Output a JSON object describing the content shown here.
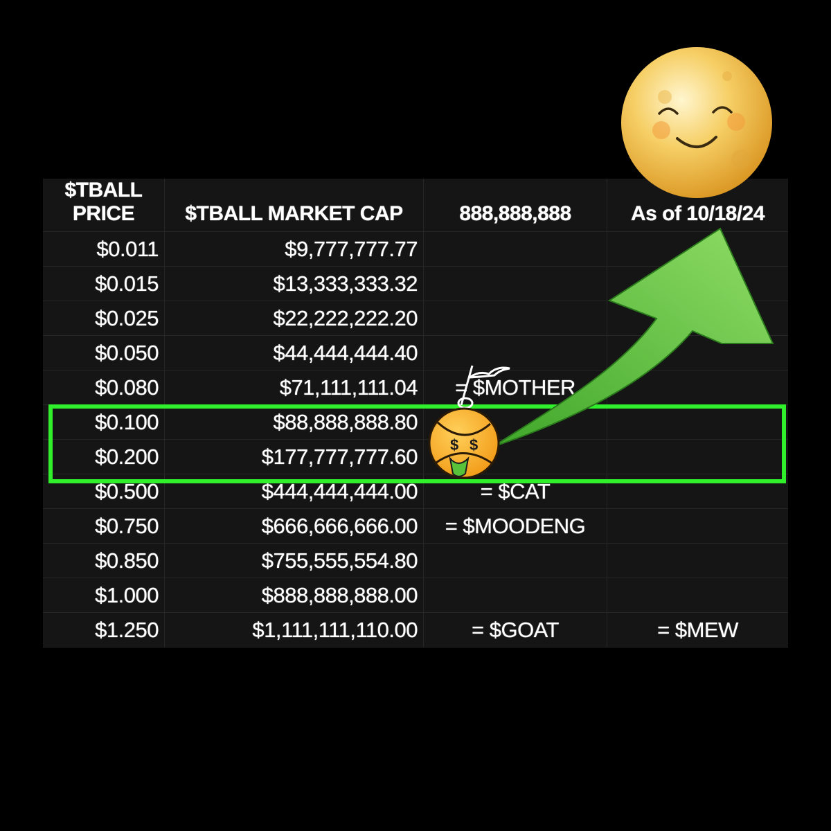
{
  "table": {
    "headers": {
      "price_line1": "$TBALL",
      "price_line2": "PRICE",
      "market_cap": "$TBALL MARKET CAP",
      "supply": "888,888,888",
      "as_of": "As of 10/18/24"
    },
    "rows": [
      {
        "price": "$0.011",
        "cap": "$9,777,777.77",
        "note1": "",
        "note2": ""
      },
      {
        "price": "$0.015",
        "cap": "$13,333,333.32",
        "note1": "",
        "note2": ""
      },
      {
        "price": "$0.025",
        "cap": "$22,222,222.20",
        "note1": "",
        "note2": ""
      },
      {
        "price": "$0.050",
        "cap": "$44,444,444.40",
        "note1": "",
        "note2": ""
      },
      {
        "price": "$0.080",
        "cap": "$71,111,111.04",
        "note1": "= $MOTHER",
        "note2": ""
      },
      {
        "price": "$0.100",
        "cap": "$88,888,888.80",
        "note1": "",
        "note2": ""
      },
      {
        "price": "$0.200",
        "cap": "$177,777,777.60",
        "note1": "",
        "note2": ""
      },
      {
        "price": "$0.500",
        "cap": "$444,444,444.00",
        "note1": "= $CAT",
        "note2": ""
      },
      {
        "price": "$0.750",
        "cap": "$666,666,666.00",
        "note1": "= $MOODENG",
        "note2": ""
      },
      {
        "price": "$0.850",
        "cap": "$755,555,554.80",
        "note1": "",
        "note2": ""
      },
      {
        "price": "$1.000",
        "cap": "$888,888,888.00",
        "note1": "",
        "note2": ""
      },
      {
        "price": "$1.250",
        "cap": "$1,111,111,110.00",
        "note1": "= $GOAT",
        "note2": "= $MEW"
      }
    ]
  },
  "highlight": {
    "rows": [
      "$0.100",
      "$0.200"
    ],
    "color": "#2ff02a"
  },
  "illustrations": {
    "moon": "smiling-moon-icon",
    "arrow": "green-up-arrow-icon",
    "mascot": "tennis-ball-mascot-icon",
    "mascot_eye_symbol": "$"
  },
  "colors": {
    "background": "#000000",
    "table_bg": "#151515",
    "arrow": "#5fcf3a",
    "moon": "#f2c14e"
  }
}
